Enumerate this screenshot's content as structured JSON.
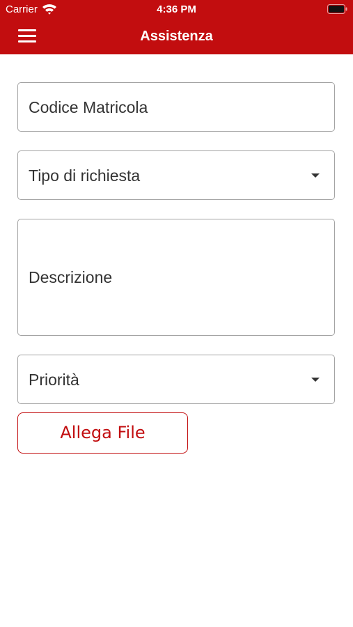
{
  "status_bar": {
    "carrier": "Carrier",
    "time": "4:36 PM",
    "wifi_icon": "wifi-icon",
    "battery_icon": "battery-icon"
  },
  "header": {
    "title": "Assistenza",
    "menu_icon": "hamburger-menu-icon",
    "background_color": "#c20d0f"
  },
  "form": {
    "codice_matricola": {
      "placeholder": "Codice Matricola",
      "value": ""
    },
    "tipo_richiesta": {
      "placeholder": "Tipo di richiesta",
      "value": "",
      "dropdown_icon": "caret-down-icon"
    },
    "descrizione": {
      "placeholder": "Descrizione",
      "value": ""
    },
    "priorita": {
      "placeholder": "Priorità",
      "value": "",
      "dropdown_icon": "caret-down-icon"
    },
    "allega_file_label": "Allega File"
  },
  "colors": {
    "accent": "#c20d0f",
    "field_border": "#a3a3a3",
    "text": "#333333"
  }
}
